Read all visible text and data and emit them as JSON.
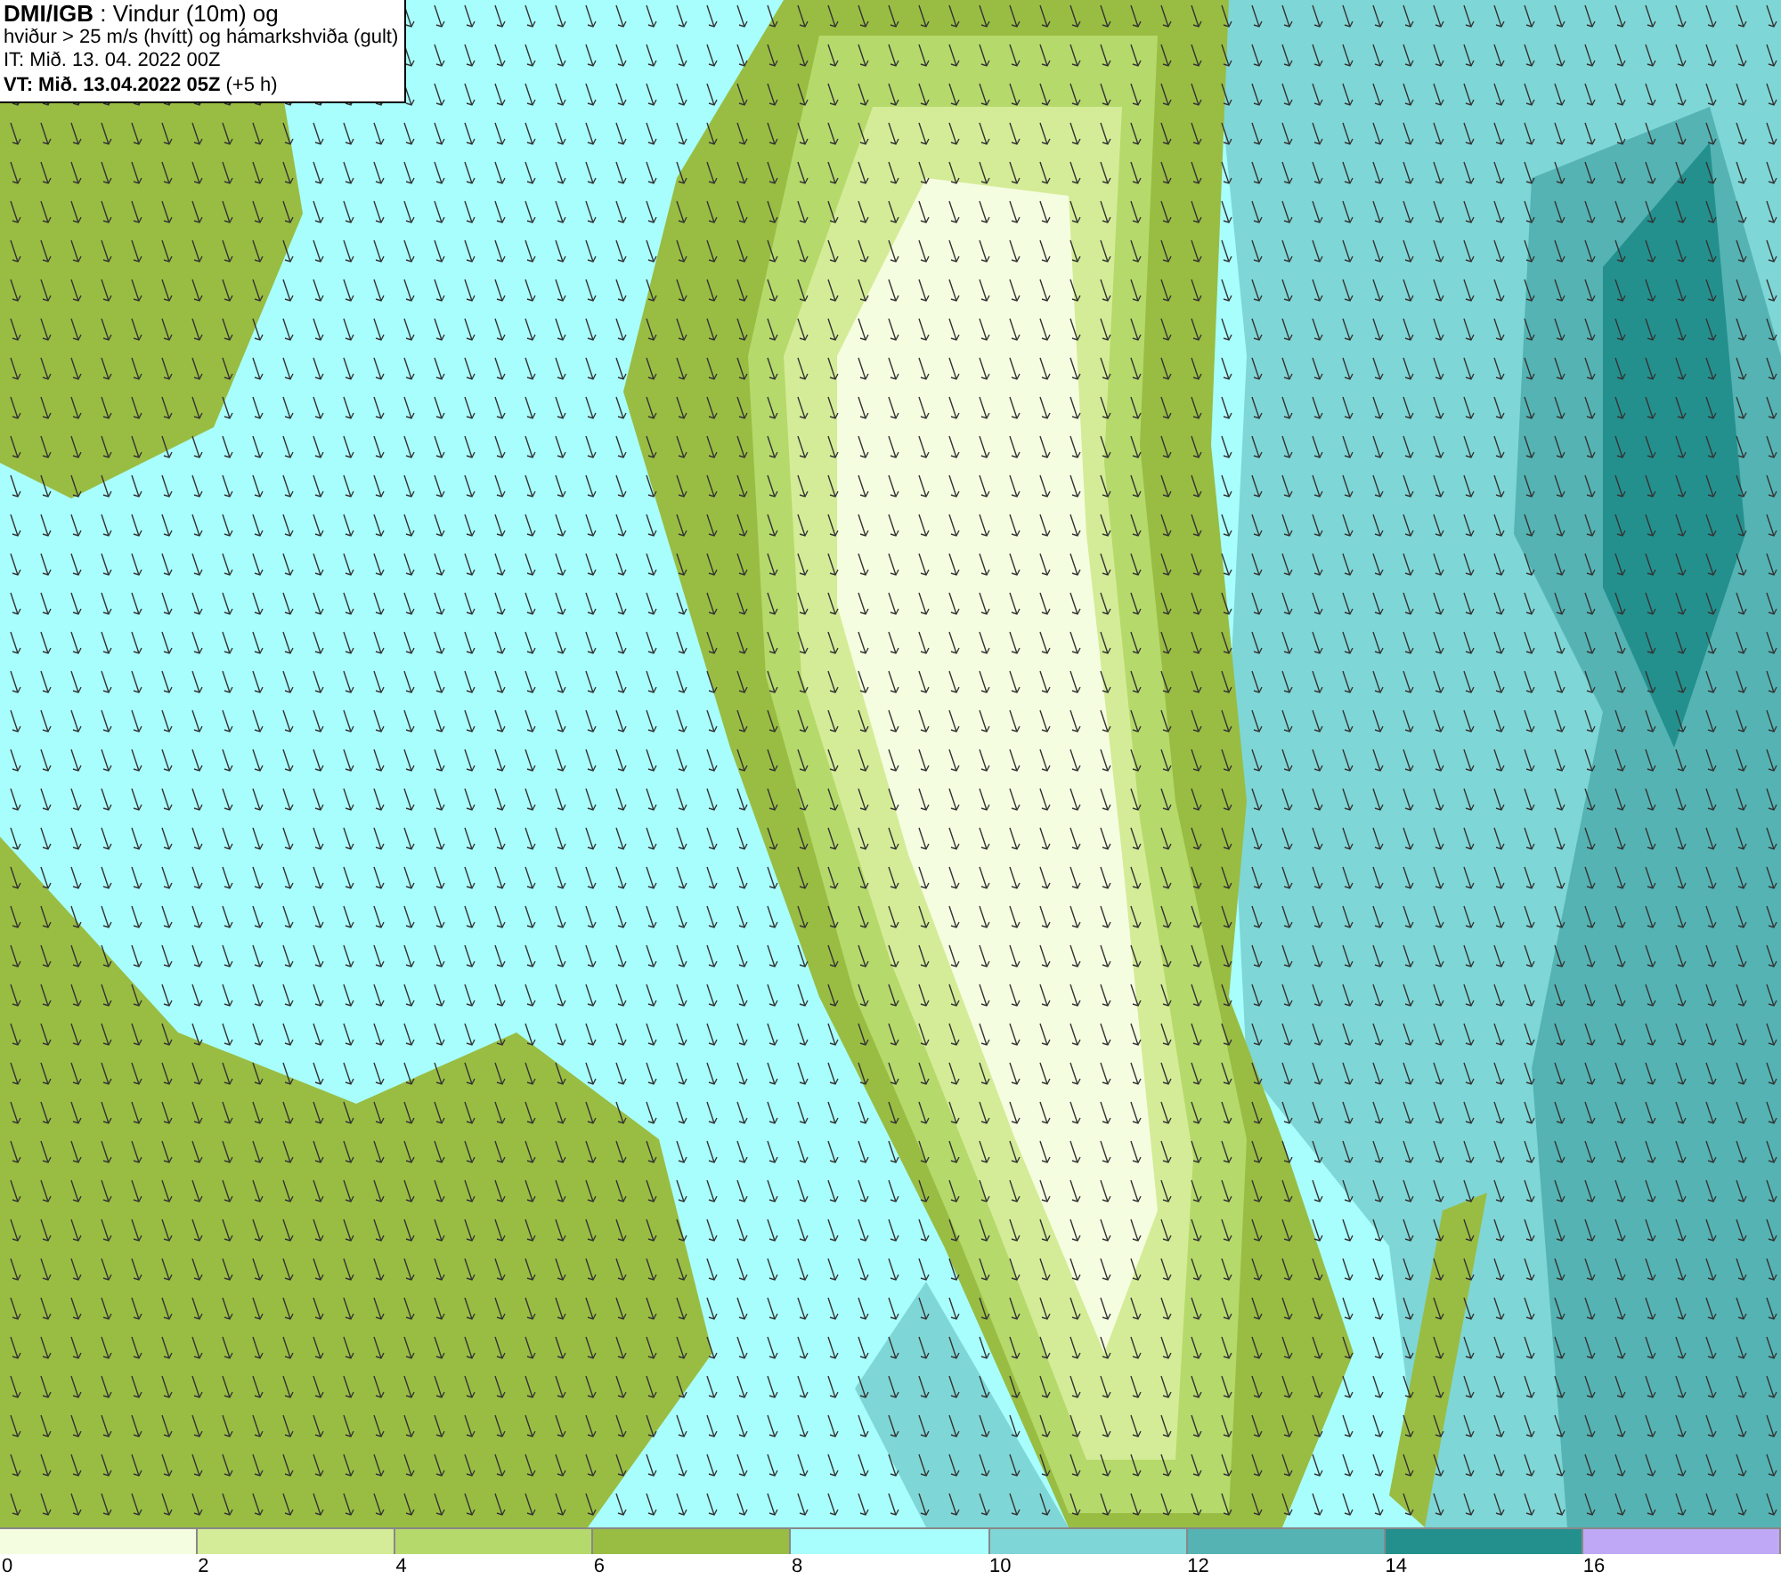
{
  "info_box": {
    "lines": [
      "**DMI/IGB** : Vindur (10m) og",
      "hviður > 25 m/s (hvítt) og hámarkshviða (gult)",
      "IT: Mið. 13. 04. 2022 00Z",
      "**VT: Mið. 13.04.2022 05Z** (+5 h)"
    ]
  },
  "legend": {
    "bins": [
      {
        "color": "#f5fde0"
      },
      {
        "color": "#d4ec97"
      },
      {
        "color": "#b5d96b"
      },
      {
        "color": "#99bd42"
      },
      {
        "color": "#a8fdfd"
      },
      {
        "color": "#7fd6d6"
      },
      {
        "color": "#55b3b3"
      },
      {
        "color": "#23908e"
      },
      {
        "color": "#bfa8f5"
      }
    ],
    "ticks": [
      "0",
      "2",
      "4",
      "6",
      "8",
      "10",
      "12",
      "14",
      "16"
    ]
  }
}
